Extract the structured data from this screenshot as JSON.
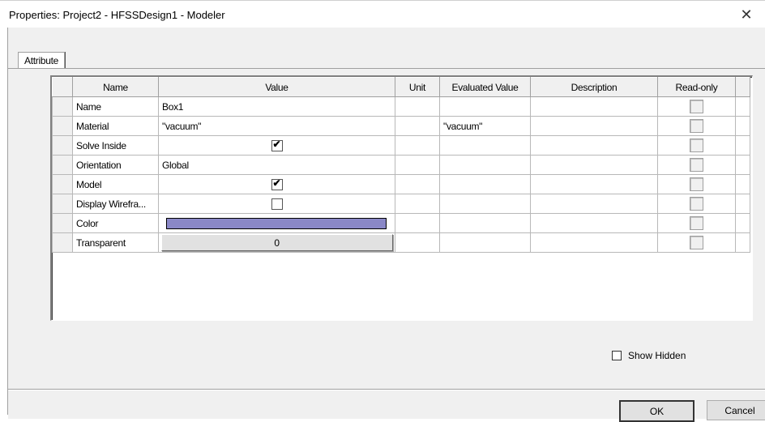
{
  "window": {
    "title": "Properties: Project2 - HFSSDesign1 - Modeler",
    "close_glyph": "✕"
  },
  "tabs": [
    {
      "label": "Attribute"
    }
  ],
  "grid": {
    "columns": [
      "Name",
      "Value",
      "Unit",
      "Evaluated Value",
      "Description",
      "Read-only"
    ],
    "rows": [
      {
        "name": "Name",
        "value": "Box1",
        "unit": "",
        "evaluated": "",
        "description": ""
      },
      {
        "name": "Material",
        "value": "\"vacuum\"",
        "unit": "",
        "evaluated": "\"vacuum\"",
        "description": ""
      },
      {
        "name": "Solve Inside",
        "value_checked": true,
        "unit": "",
        "evaluated": "",
        "description": ""
      },
      {
        "name": "Orientation",
        "value": "Global",
        "unit": "",
        "evaluated": "",
        "description": ""
      },
      {
        "name": "Model",
        "value_checked": true,
        "unit": "",
        "evaluated": "",
        "description": ""
      },
      {
        "name": "Display Wirefra...",
        "value_checked": false,
        "unit": "",
        "evaluated": "",
        "description": ""
      },
      {
        "name": "Color",
        "value_color": "#8a88c7",
        "unit": "",
        "evaluated": "",
        "description": ""
      },
      {
        "name": "Transparent",
        "value": "0",
        "unit": "",
        "evaluated": "",
        "description": ""
      }
    ],
    "check_glyph": "✔"
  },
  "show_hidden": {
    "label": "Show Hidden",
    "checked": false
  },
  "buttons": {
    "ok": "OK",
    "cancel": "Cancel"
  }
}
